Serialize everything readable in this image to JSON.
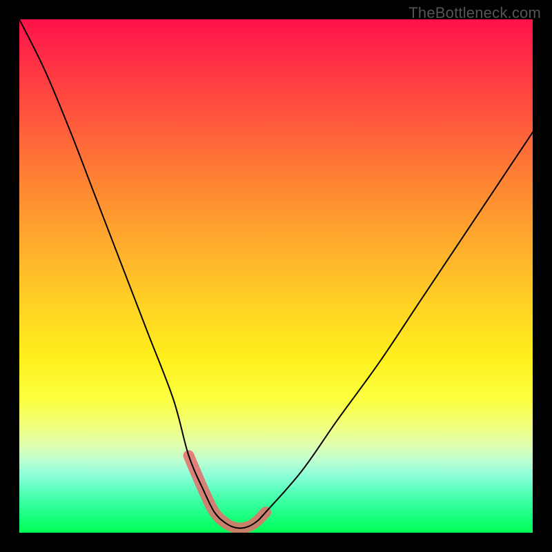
{
  "watermark": {
    "text": "TheBottleneck.com"
  },
  "chart_data": {
    "type": "line",
    "title": "",
    "xlabel": "",
    "ylabel": "",
    "ylim": [
      0,
      100
    ],
    "xlim": [
      0,
      100
    ],
    "x": [
      0,
      5,
      10,
      15,
      20,
      25,
      30,
      33,
      36,
      38,
      40,
      42,
      44,
      46,
      48,
      55,
      62,
      70,
      78,
      86,
      94,
      100
    ],
    "values": [
      100,
      90,
      78,
      65,
      52,
      39,
      26,
      15,
      8,
      4,
      2,
      1,
      1,
      2,
      4,
      12,
      22,
      33,
      45,
      57,
      69,
      78
    ],
    "trough_range_x": [
      33,
      48
    ],
    "series": [
      {
        "name": "bottleneck-curve",
        "x": [
          0,
          5,
          10,
          15,
          20,
          25,
          30,
          33,
          36,
          38,
          40,
          42,
          44,
          46,
          48,
          55,
          62,
          70,
          78,
          86,
          94,
          100
        ],
        "values": [
          100,
          90,
          78,
          65,
          52,
          39,
          26,
          15,
          8,
          4,
          2,
          1,
          1,
          2,
          4,
          12,
          22,
          33,
          45,
          57,
          69,
          78
        ]
      }
    ]
  }
}
